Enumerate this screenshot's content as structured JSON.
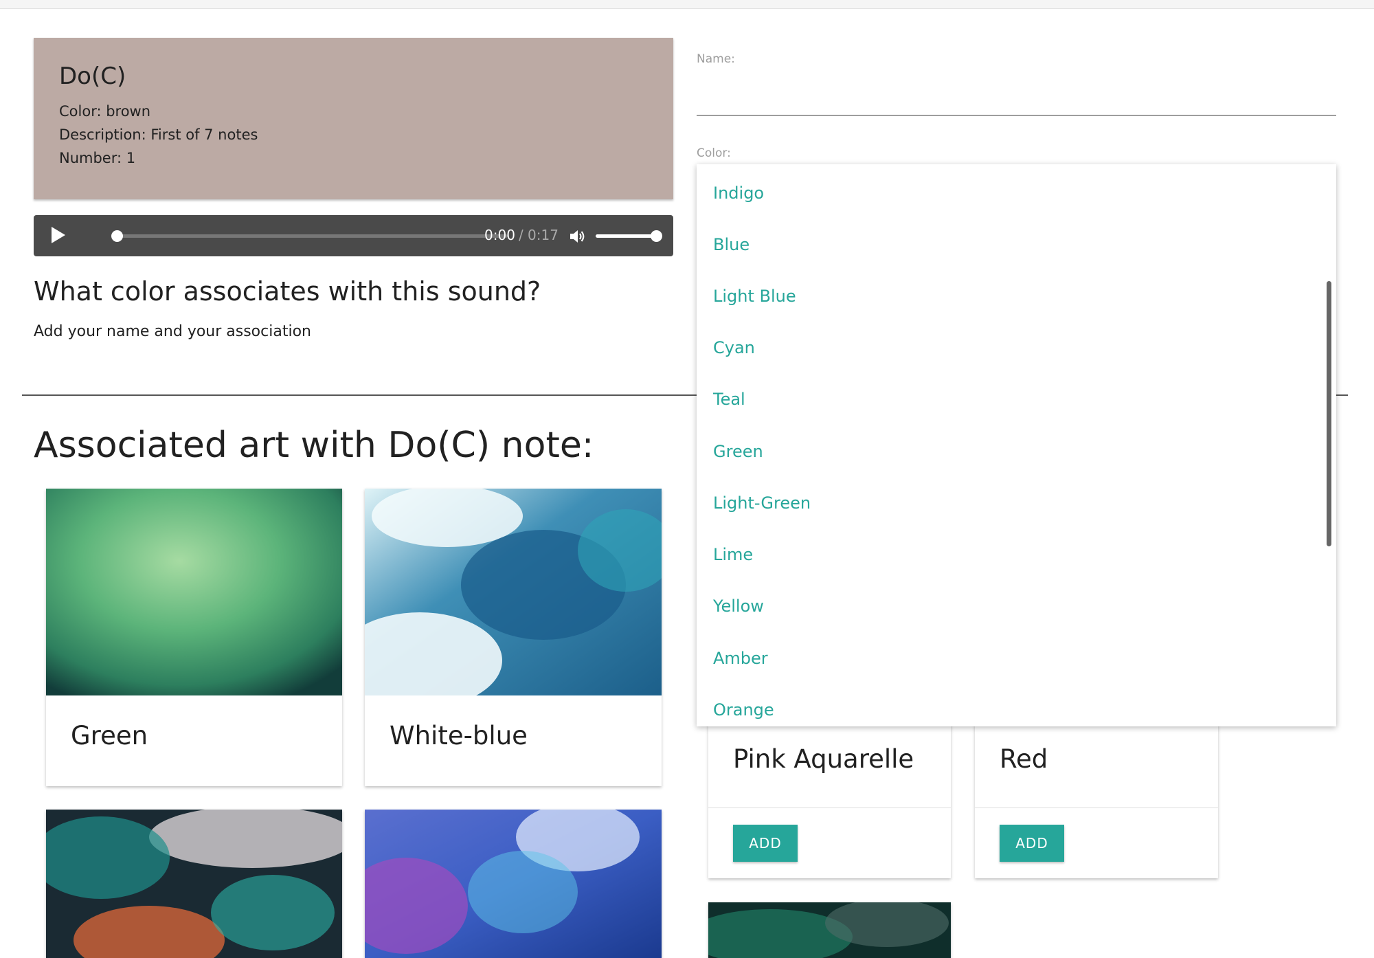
{
  "note": {
    "title": "Do(C)",
    "color_line": "Color: brown",
    "description_line": "Description: First of 7 notes",
    "number_line": "Number: 1",
    "card_color": "#bcaaa4"
  },
  "audio": {
    "current_time": "0:00",
    "separator": "/",
    "duration": "0:17",
    "progress": 0,
    "volume": 1
  },
  "prompt": {
    "question": "What color associates with this sound?",
    "instruction": "Add your name and your association"
  },
  "form": {
    "name_label": "Name:",
    "name_value": "",
    "color_label": "Color:"
  },
  "color_dropdown": {
    "options": [
      "Indigo",
      "Blue",
      "Light Blue",
      "Cyan",
      "Teal",
      "Green",
      "Light-Green",
      "Lime",
      "Yellow",
      "Amber",
      "Orange"
    ]
  },
  "art": {
    "section_title": "Associated art with Do(C) note:",
    "left_cards": [
      {
        "label": "Green"
      },
      {
        "label": "White-blue"
      }
    ],
    "right_cards": [
      {
        "label": "Pink Aquarelle",
        "button": "ADD"
      },
      {
        "label": "Red",
        "button": "ADD"
      }
    ]
  },
  "colors": {
    "accent": "#26a69a",
    "player_bg": "#4a4a4a"
  }
}
